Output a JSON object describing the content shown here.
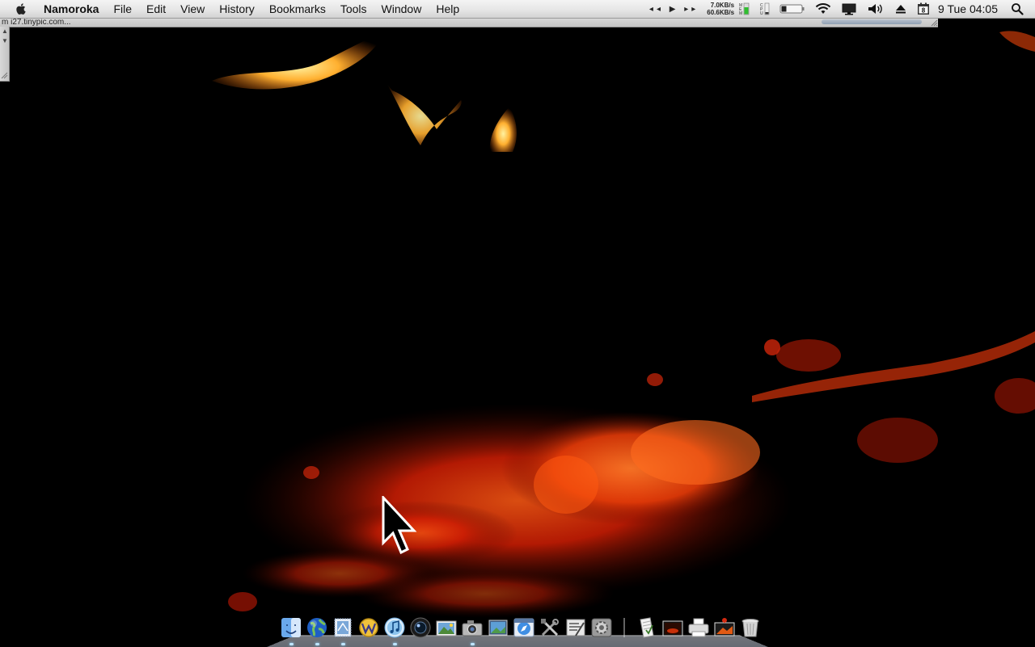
{
  "menubar": {
    "app_name": "Namoroka",
    "items": [
      "File",
      "Edit",
      "View",
      "History",
      "Bookmarks",
      "Tools",
      "Window",
      "Help"
    ],
    "net_up": "7.0KB/s",
    "net_down": "60.6KB/s",
    "calendar_badge": "8",
    "clock": "9 Tue 04:05",
    "icons": [
      "apple-icon",
      "media-controls-icon",
      "memory-meter-icon",
      "cpu-meter-icon",
      "battery-icon",
      "wifi-icon",
      "display-icon",
      "volume-icon",
      "eject-icon",
      "calendar-icon",
      "spotlight-icon"
    ]
  },
  "window": {
    "status_text": "m i27.tinypic.com..."
  },
  "dock": {
    "apps": [
      {
        "name": "finder-icon",
        "running": true
      },
      {
        "name": "globe-browser-icon",
        "running": true
      },
      {
        "name": "mail-stamp-icon",
        "running": true
      },
      {
        "name": "wallet-w-icon",
        "running": false
      },
      {
        "name": "itunes-icon",
        "running": true
      },
      {
        "name": "photo-booth-lens-icon",
        "running": false
      },
      {
        "name": "iphoto-icon",
        "running": false
      },
      {
        "name": "camera-icon",
        "running": true
      },
      {
        "name": "preview-photos-icon",
        "running": false
      },
      {
        "name": "safari-icon",
        "running": false
      },
      {
        "name": "utilities-tools-icon",
        "running": false
      },
      {
        "name": "script-editor-icon",
        "running": false
      },
      {
        "name": "system-preferences-icon",
        "running": false
      }
    ],
    "stacks": [
      "documents-stack-icon",
      "folder-stack-icon",
      "printer-icon",
      "downloads-stack-icon",
      "trash-icon"
    ]
  },
  "colors": {
    "menubar_top": "#f4f4f4",
    "menubar_bottom": "#d2d2d2",
    "wallpaper": "#000000",
    "ember": "#c81e05",
    "flame": "#ff9a1a"
  }
}
